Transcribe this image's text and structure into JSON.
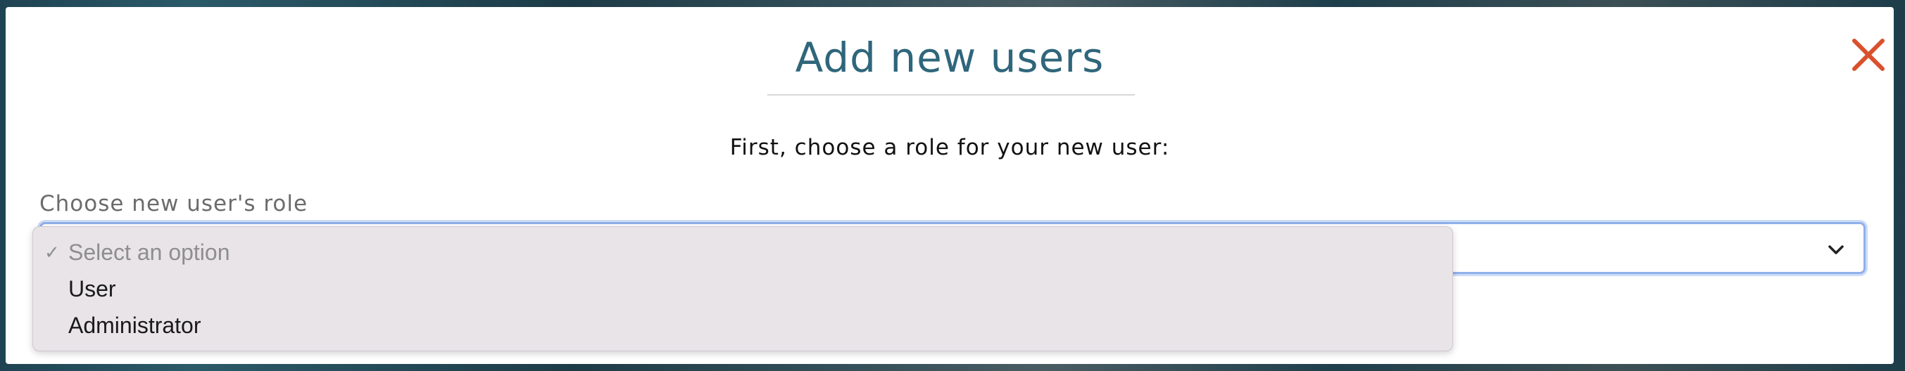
{
  "modal": {
    "title": "Add new users",
    "instruction": "First, choose a role for your new user:",
    "close_icon": "close-icon",
    "accent_color": "#2f667b",
    "close_color": "#d9512c"
  },
  "role_select": {
    "label": "Choose new user's role",
    "selected": "Select an option",
    "options": [
      {
        "label": "Select an option",
        "checked": true
      },
      {
        "label": "User",
        "checked": false
      },
      {
        "label": "Administrator",
        "checked": false
      }
    ],
    "check_glyph": "✓"
  }
}
